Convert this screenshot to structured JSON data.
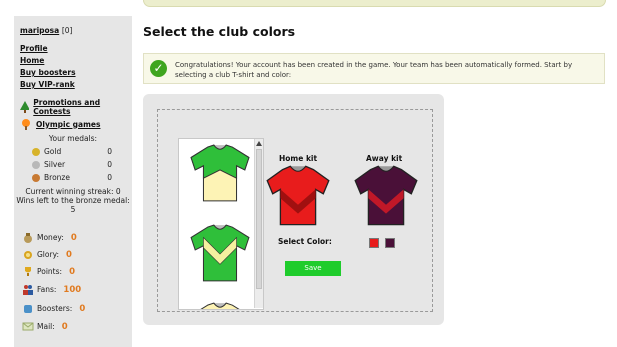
{
  "sidebar": {
    "username": "mariposa",
    "user_count": "[0]",
    "menu": [
      "Profile",
      "Home",
      "Buy boosters",
      "Buy VIP-rank"
    ],
    "promotions": "Promotions and Contests",
    "olympic": "Olympic games",
    "medals_title": "Your medals:",
    "medals": [
      {
        "name": "Gold",
        "value": "0",
        "color": "#d7b32a"
      },
      {
        "name": "Silver",
        "value": "0",
        "color": "#b8b8b8"
      },
      {
        "name": "Bronze",
        "value": "0",
        "color": "#c87a33"
      }
    ],
    "streak": "Current winning streak: 0",
    "bronze_wins_label": "Wins left to the bronze medal:",
    "bronze_wins_value": "5",
    "resources": [
      {
        "label": "Money:",
        "value": "0",
        "icon": "money-bag-icon"
      },
      {
        "label": "Glory:",
        "value": "0",
        "icon": "glory-icon"
      },
      {
        "label": "Points:",
        "value": "0",
        "icon": "trophy-icon"
      },
      {
        "label": "Fans:",
        "value": "100",
        "icon": "fans-icon"
      },
      {
        "label": "Boosters:",
        "value": "0",
        "icon": "booster-icon"
      },
      {
        "label": "Mail:",
        "value": "0",
        "icon": "mail-icon"
      }
    ]
  },
  "main": {
    "title": "Select the club colors",
    "notice": "Congratulations! Your account has been created in the game. Your team has been automatically formed. Start by selecting a club T-shirt and color:",
    "home_kit_label": "Home kit",
    "away_kit_label": "Away kit",
    "select_color_label": "Select Color:",
    "save_label": "Save",
    "home_color": "#e81c1c",
    "away_color": "#4a1038"
  }
}
